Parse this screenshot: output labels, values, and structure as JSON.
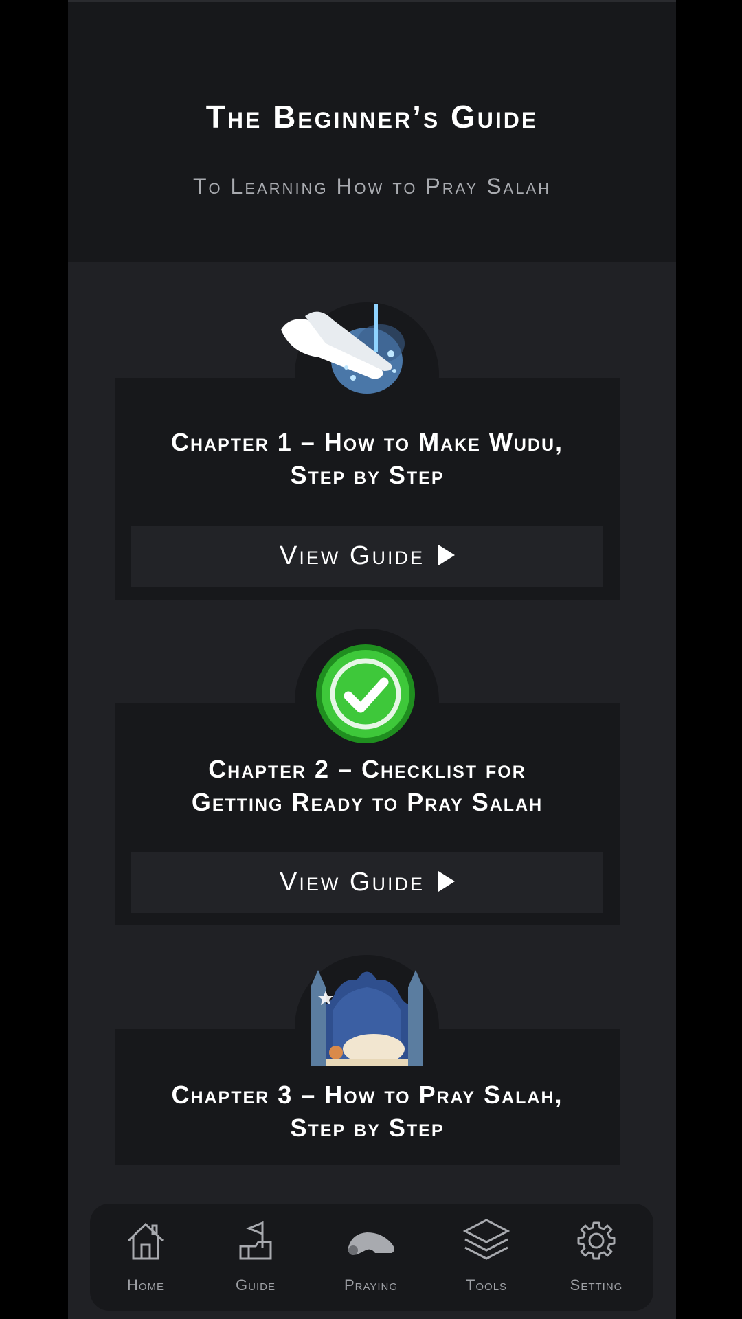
{
  "header": {
    "title": "The Beginner’s Guide",
    "subtitle": "To Learning How to Pray Salah"
  },
  "chapters": [
    {
      "title_line1": "Chapter 1 – How to Make Wudu,",
      "title_line2": "Step by Step",
      "button": "View Guide",
      "icon": "wudu-hands-icon"
    },
    {
      "title_line1": "Chapter 2 – Checklist for",
      "title_line2": "Getting Ready to Pray Salah",
      "button": "View Guide",
      "icon": "checkmark-badge-icon"
    },
    {
      "title_line1": "Chapter 3 – How to Pray Salah,",
      "title_line2": "Step by Step",
      "icon": "mosque-prayer-icon"
    }
  ],
  "nav": [
    {
      "label": "Home",
      "icon": "home-icon"
    },
    {
      "label": "Guide",
      "icon": "guide-flag-icon"
    },
    {
      "label": "Praying",
      "icon": "praying-icon"
    },
    {
      "label": "Tools",
      "icon": "layers-icon"
    },
    {
      "label": "Setting",
      "icon": "gear-icon"
    }
  ],
  "colors": {
    "background": "#202125",
    "card": "#17181b",
    "accent_green": "#3ec83a"
  }
}
